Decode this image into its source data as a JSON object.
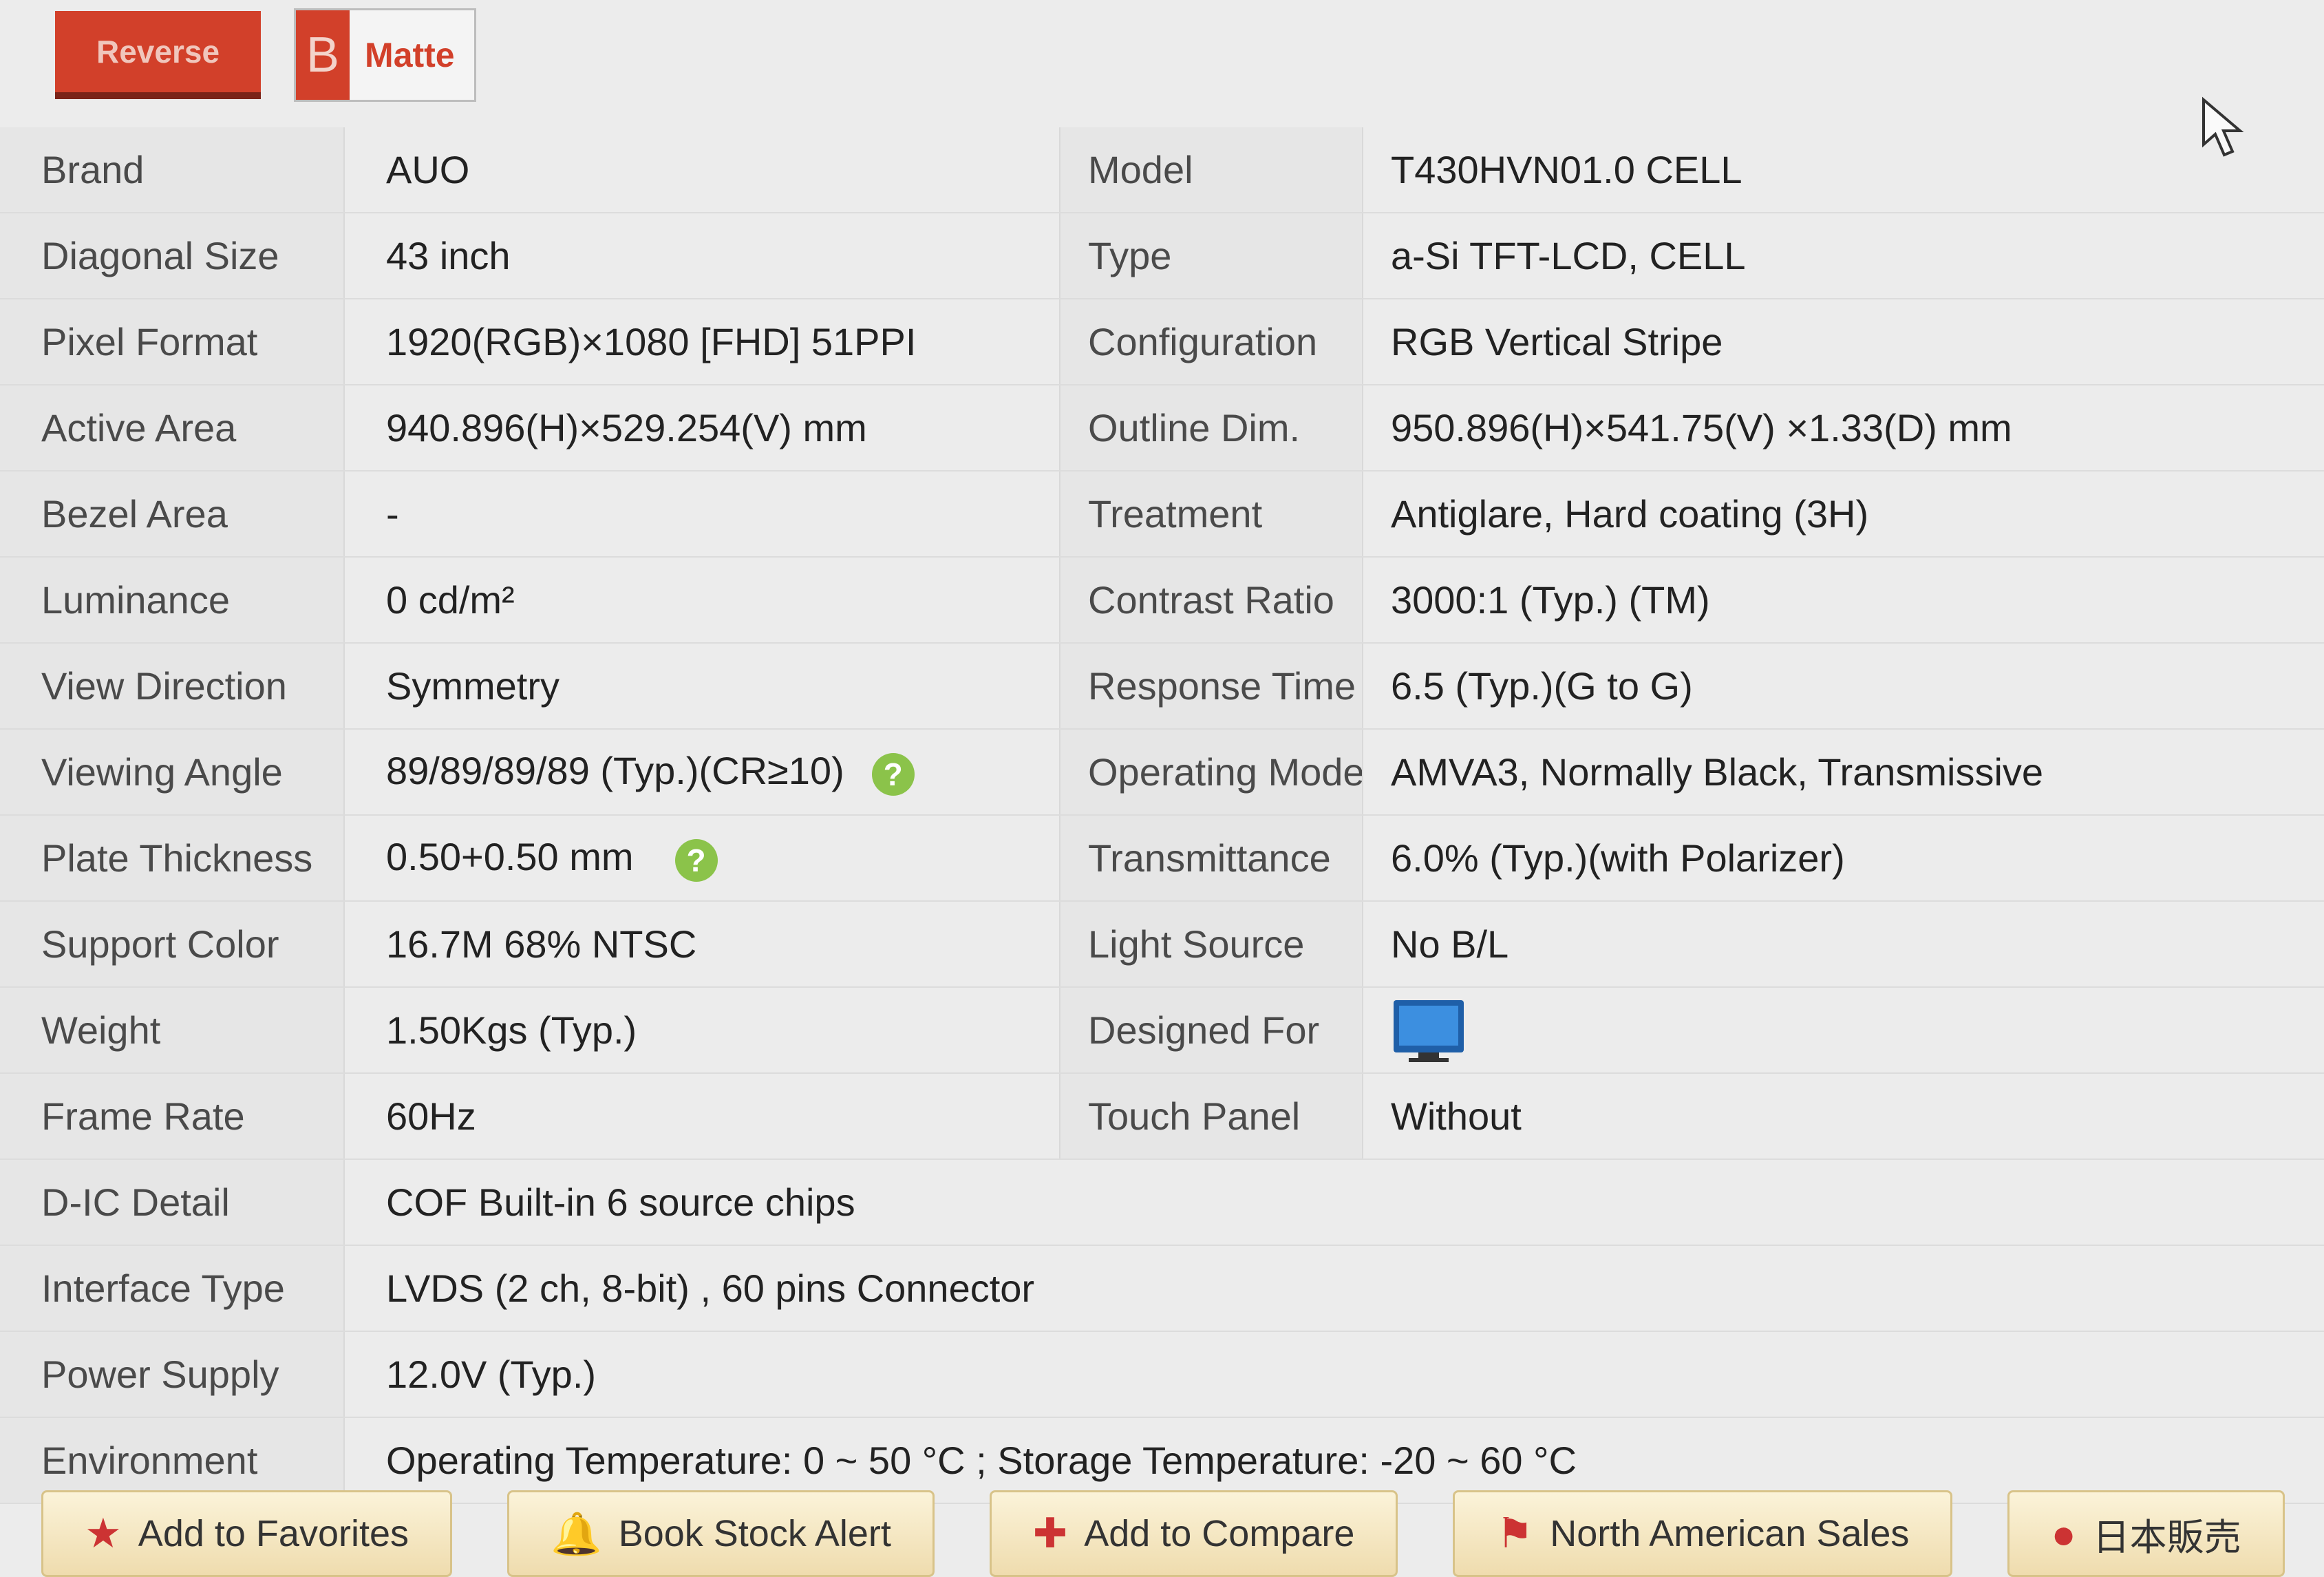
{
  "tags": {
    "reverse": "Reverse",
    "b": "B",
    "matte": "Matte"
  },
  "specs_left": [
    {
      "label": "Brand",
      "value": "AUO"
    },
    {
      "label": "Diagonal Size",
      "value": "43 inch"
    },
    {
      "label": "Pixel Format",
      "value": "1920(RGB)×1080  [FHD]  51PPI"
    },
    {
      "label": "Active Area",
      "value": "940.896(H)×529.254(V) mm"
    },
    {
      "label": "Bezel Area",
      "value": "-"
    },
    {
      "label": "Luminance",
      "value": "0 cd/m²"
    },
    {
      "label": "View Direction",
      "value": "Symmetry"
    },
    {
      "label": "Viewing Angle",
      "value": "89/89/89/89 (Typ.)(CR≥10)"
    },
    {
      "label": "Plate Thickness",
      "value": "0.50+0.50 mm"
    },
    {
      "label": "Support Color",
      "value": "16.7M   68% NTSC"
    },
    {
      "label": "Weight",
      "value": "1.50Kgs (Typ.)"
    },
    {
      "label": "Frame Rate",
      "value": "60Hz"
    }
  ],
  "specs_right": [
    {
      "label": "Model",
      "value": "T430HVN01.0 CELL"
    },
    {
      "label": "Type",
      "value": "a-Si TFT-LCD, CELL"
    },
    {
      "label": "Configuration",
      "value": "RGB Vertical Stripe"
    },
    {
      "label": "Outline Dim.",
      "value": "950.896(H)×541.75(V) ×1.33(D) mm"
    },
    {
      "label": "Treatment",
      "value": "Antiglare, Hard coating (3H)"
    },
    {
      "label": "Contrast Ratio",
      "value": "3000:1 (Typ.) (TM)"
    },
    {
      "label": "Response Time",
      "value": "6.5 (Typ.)(G to G)"
    },
    {
      "label": "Operating Mode",
      "value": "AMVA3, Normally Black, Transmissive"
    },
    {
      "label": "Transmittance",
      "value": "6.0% (Typ.)(with Polarizer)"
    },
    {
      "label": "Light Source",
      "value": "No B/L"
    },
    {
      "label": "Designed For",
      "value": ""
    },
    {
      "label": "Touch Panel",
      "value": "Without"
    }
  ],
  "specs_full": [
    {
      "label": "D-IC Detail",
      "value": "COF Built-in 6 source chips"
    },
    {
      "label": "Interface Type",
      "value": "LVDS (2 ch, 8-bit) , 60 pins Connector"
    },
    {
      "label": "Power Supply",
      "value": "12.0V (Typ.)"
    },
    {
      "label": "Environment",
      "value": "Operating Temperature: 0 ~ 50 °C ; Storage Temperature: -20 ~ 60 °C"
    }
  ],
  "help_icon": "?",
  "icons": {
    "help": "help-circle-icon",
    "designed_for": "monitor-icon"
  },
  "actions": {
    "favorites": "Add to Favorites",
    "stock_alert": "Book Stock Alert",
    "compare": "Add to Compare",
    "na_sales": "North American Sales",
    "jp_sales": "日本販売"
  },
  "colors": {
    "accent": "#d2402a",
    "help": "#8bc34a"
  }
}
